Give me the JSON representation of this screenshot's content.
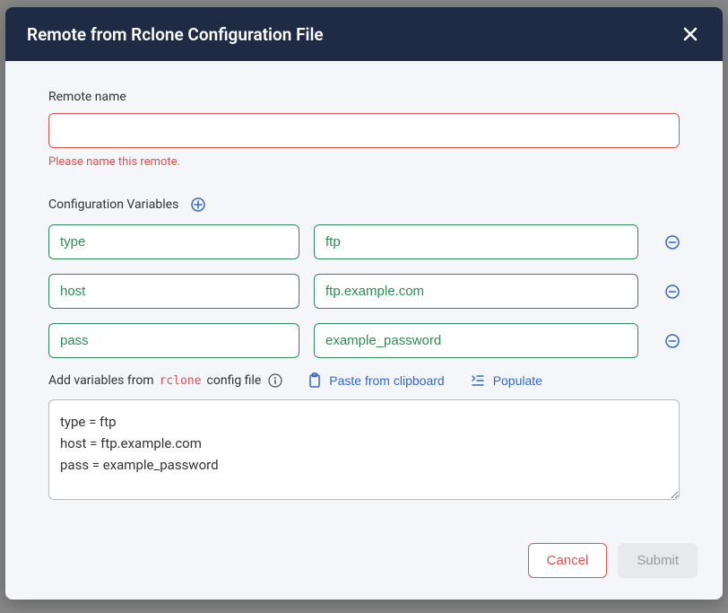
{
  "modal": {
    "title": "Remote from Rclone Configuration File"
  },
  "remoteName": {
    "label": "Remote name",
    "value": "",
    "error": "Please name this remote."
  },
  "configVars": {
    "label": "Configuration Variables",
    "rows": [
      {
        "key": "type",
        "value": "ftp"
      },
      {
        "key": "host",
        "value": "ftp.example.com"
      },
      {
        "key": "pass",
        "value": "example_password"
      }
    ]
  },
  "configFile": {
    "prefix": "Add variables from ",
    "code": "rclone",
    "suffix": " config file",
    "pasteLabel": "Paste from clipboard",
    "populateLabel": "Populate",
    "textarea": "type = ftp\nhost = ftp.example.com\npass = example_password"
  },
  "footer": {
    "cancel": "Cancel",
    "submit": "Submit"
  }
}
